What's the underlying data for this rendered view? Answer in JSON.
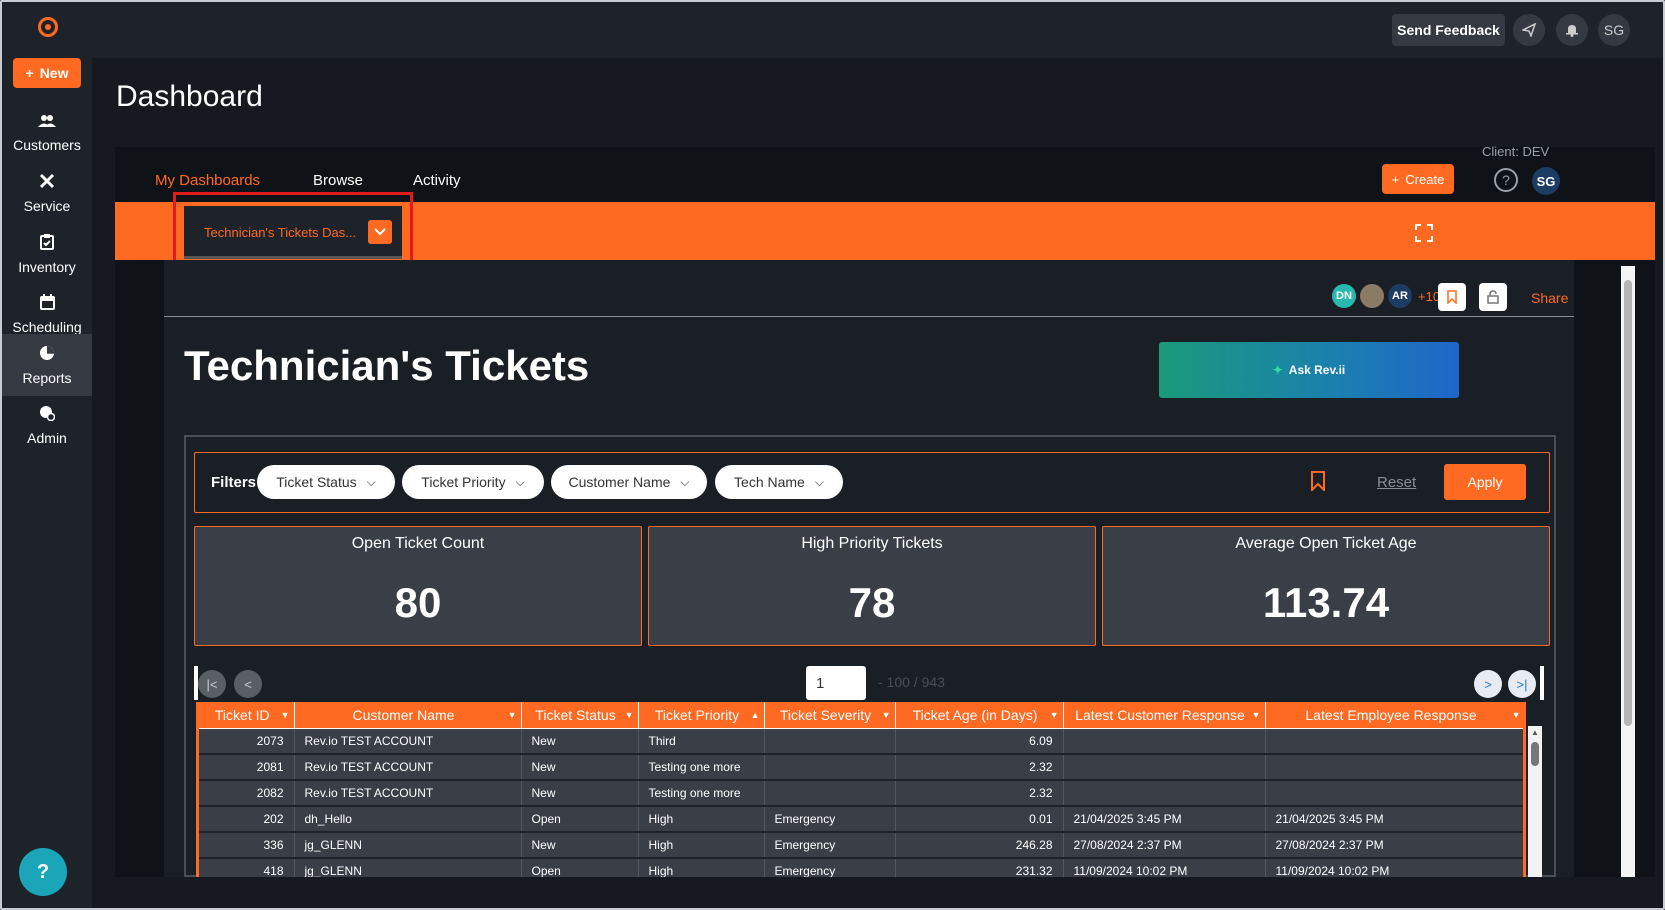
{
  "app": {
    "new_label": "New",
    "send_feedback": "Send Feedback",
    "user_initials": "SG",
    "help_glyph": "?"
  },
  "sidebar": {
    "items": [
      {
        "label": "Customers",
        "icon": "people-icon"
      },
      {
        "label": "Service",
        "icon": "tools-icon"
      },
      {
        "label": "Inventory",
        "icon": "clipboard-icon"
      },
      {
        "label": "Scheduling",
        "icon": "calendar-icon"
      },
      {
        "label": "Reports",
        "icon": "pie-chart-icon"
      },
      {
        "label": "Admin",
        "icon": "admin-gear-icon"
      }
    ]
  },
  "page": {
    "title": "Dashboard"
  },
  "dashboard": {
    "client_label": "Client: DEV",
    "tabs": [
      "My Dashboards",
      "Browse",
      "Activity"
    ],
    "active_tab": "My Dashboards",
    "create_label": "Create",
    "selected_dashboard": "Technician's Tickets Das...",
    "accent_color": "#ff6a22"
  },
  "report": {
    "title": "Technician's Tickets",
    "ask_label": "Ask Rev.ii",
    "viewers": [
      "DN",
      "AR"
    ],
    "more_viewers": "+10",
    "share_label": "Share"
  },
  "filters": {
    "label": "Filters",
    "items": [
      "Ticket Status",
      "Ticket Priority",
      "Customer Name",
      "Tech Name"
    ],
    "reset_label": "Reset",
    "apply_label": "Apply"
  },
  "kpis": [
    {
      "title": "Open Ticket Count",
      "value": "80"
    },
    {
      "title": "High Priority Tickets",
      "value": "78"
    },
    {
      "title": "Average Open Ticket Age",
      "value": "113.74"
    }
  ],
  "pager": {
    "current_page": "1",
    "range_text": "- 100 / 943"
  },
  "table": {
    "columns": [
      "Ticket ID",
      "Customer Name",
      "Ticket Status",
      "Ticket Priority",
      "Ticket Severity",
      "Ticket Age (in Days)",
      "Latest Customer Response",
      "Latest Employee Response"
    ],
    "rows": [
      [
        "2073",
        "Rev.io TEST ACCOUNT",
        "New",
        "Third",
        "",
        "6.09",
        "",
        ""
      ],
      [
        "2081",
        "Rev.io TEST ACCOUNT",
        "New",
        "Testing one more",
        "",
        "2.32",
        "",
        ""
      ],
      [
        "2082",
        "Rev.io TEST ACCOUNT",
        "New",
        "Testing one more",
        "",
        "2.32",
        "",
        ""
      ],
      [
        "202",
        "dh_Hello",
        "Open",
        "High",
        "Emergency",
        "0.01",
        "21/04/2025 3:45 PM",
        "21/04/2025 3:45 PM"
      ],
      [
        "336",
        "jg_GLENN",
        "New",
        "High",
        "Emergency",
        "246.28",
        "27/08/2024 2:37 PM",
        "27/08/2024 2:37 PM"
      ],
      [
        "418",
        "jg_GLENN",
        "Open",
        "High",
        "Emergency",
        "231.32",
        "11/09/2024 10:02 PM",
        "11/09/2024 10:02 PM"
      ]
    ]
  }
}
